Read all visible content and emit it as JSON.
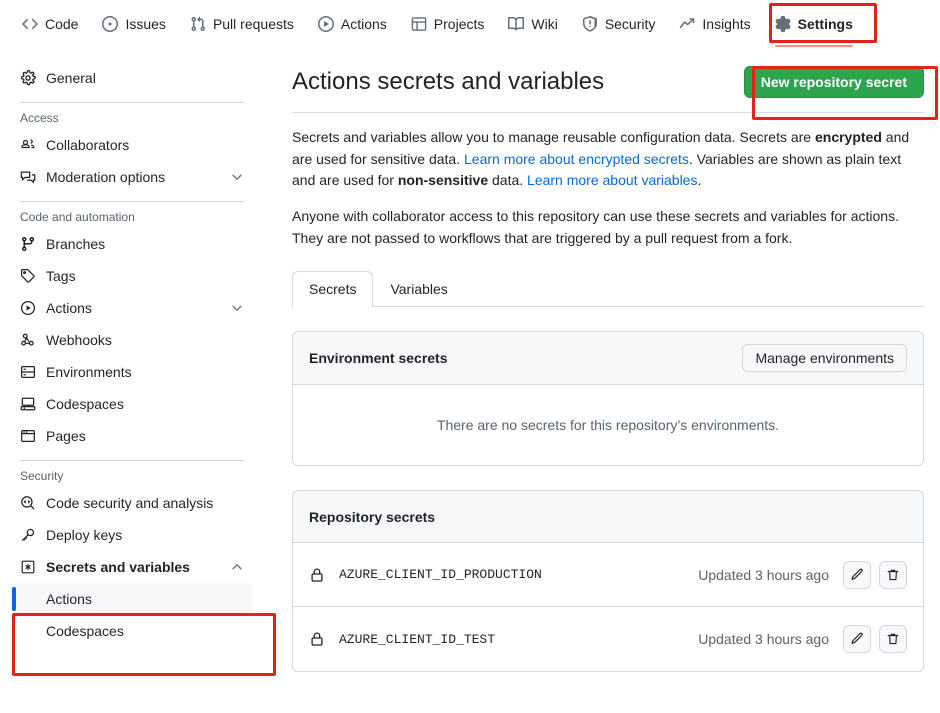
{
  "topnav": {
    "items": [
      {
        "label": "Code",
        "icon": "code-icon",
        "active": false
      },
      {
        "label": "Issues",
        "icon": "issue-opened-icon",
        "active": false
      },
      {
        "label": "Pull requests",
        "icon": "git-pull-request-icon",
        "active": false
      },
      {
        "label": "Actions",
        "icon": "play-icon",
        "active": false
      },
      {
        "label": "Projects",
        "icon": "table-icon",
        "active": false
      },
      {
        "label": "Wiki",
        "icon": "book-icon",
        "active": false
      },
      {
        "label": "Security",
        "icon": "shield-icon",
        "active": false
      },
      {
        "label": "Insights",
        "icon": "graph-icon",
        "active": false
      },
      {
        "label": "Settings",
        "icon": "gear-icon",
        "active": true
      }
    ]
  },
  "sidebar": {
    "general": {
      "label": "General",
      "icon": "gear-icon"
    },
    "sections": [
      {
        "heading": "Access",
        "items": [
          {
            "label": "Collaborators",
            "icon": "people-icon",
            "chevron": ""
          },
          {
            "label": "Moderation options",
            "icon": "comment-discussion-icon",
            "chevron": "down"
          }
        ]
      },
      {
        "heading": "Code and automation",
        "items": [
          {
            "label": "Branches",
            "icon": "git-branch-icon",
            "chevron": ""
          },
          {
            "label": "Tags",
            "icon": "tag-icon",
            "chevron": ""
          },
          {
            "label": "Actions",
            "icon": "play-icon",
            "chevron": "down"
          },
          {
            "label": "Webhooks",
            "icon": "webhook-icon",
            "chevron": ""
          },
          {
            "label": "Environments",
            "icon": "server-icon",
            "chevron": ""
          },
          {
            "label": "Codespaces",
            "icon": "codespaces-icon",
            "chevron": ""
          },
          {
            "label": "Pages",
            "icon": "browser-icon",
            "chevron": ""
          }
        ]
      },
      {
        "heading": "Security",
        "items": [
          {
            "label": "Code security and analysis",
            "icon": "codescan-icon",
            "chevron": ""
          },
          {
            "label": "Deploy keys",
            "icon": "key-icon",
            "chevron": ""
          }
        ]
      }
    ],
    "secrets_group": {
      "label": "Secrets and variables",
      "icon": "asterisk-key-icon",
      "chevron": "up",
      "children": [
        {
          "label": "Actions",
          "selected": true
        },
        {
          "label": "Codespaces",
          "selected": false
        }
      ]
    }
  },
  "main": {
    "title": "Actions secrets and variables",
    "new_secret_button": "New repository secret",
    "paragraph1": {
      "part1": "Secrets and variables allow you to manage reusable configuration data. Secrets are ",
      "bold1": "encrypted",
      "part2": " and are used for sensitive data. ",
      "link1": "Learn more about encrypted secrets",
      "part3": ". Variables are shown as plain text and are used for ",
      "bold2": "non-sensitive",
      "part4": " data. ",
      "link2": "Learn more about variables",
      "part5": "."
    },
    "paragraph2": "Anyone with collaborator access to this repository can use these secrets and variables for actions. They are not passed to workflows that are triggered by a pull request from a fork.",
    "tabs": [
      {
        "label": "Secrets",
        "active": true
      },
      {
        "label": "Variables",
        "active": false
      }
    ],
    "environment_panel": {
      "title": "Environment secrets",
      "manage_button": "Manage environments",
      "empty_message": "There are no secrets for this repository’s environments."
    },
    "repository_panel": {
      "title": "Repository secrets",
      "rows": [
        {
          "name": "AZURE_CLIENT_ID_PRODUCTION",
          "updated": "Updated 3 hours ago",
          "edit_label": "Edit",
          "delete_label": "Delete"
        },
        {
          "name": "AZURE_CLIENT_ID_TEST",
          "updated": "Updated 3 hours ago",
          "edit_label": "Edit",
          "delete_label": "Delete"
        }
      ]
    }
  },
  "colors": {
    "green_button": "#2da44e",
    "link": "#0969da",
    "annotation_red": "#e32219",
    "active_tab_underline": "#fd8c73",
    "selected_rail_blue": "#0969da"
  }
}
